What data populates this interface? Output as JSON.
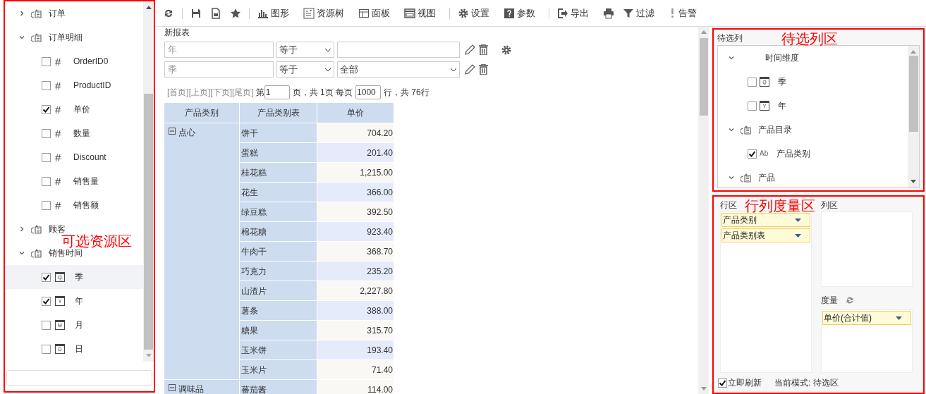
{
  "resource_panel": {
    "annotation": "可选资源区",
    "tree": [
      {
        "label": "订单",
        "kind": "table",
        "expanded": false
      },
      {
        "label": "订单明细",
        "kind": "table",
        "expanded": true,
        "children": [
          {
            "label": "OrderID0",
            "kind": "measure",
            "glyph": "#",
            "checked": false,
            "selected": false
          },
          {
            "label": "ProductID",
            "kind": "measure",
            "glyph": "#",
            "checked": false,
            "selected": false
          },
          {
            "label": "单价",
            "kind": "measure",
            "glyph": "#",
            "checked": true,
            "selected": false
          },
          {
            "label": "数量",
            "kind": "measure",
            "glyph": "#",
            "checked": false,
            "selected": false
          },
          {
            "label": "Discount",
            "kind": "measure",
            "glyph": "#",
            "checked": false,
            "selected": false
          },
          {
            "label": "销售量",
            "kind": "measure",
            "glyph": "#",
            "checked": false,
            "selected": false
          },
          {
            "label": "销售额",
            "kind": "measure",
            "glyph": "#",
            "checked": false,
            "selected": false
          }
        ]
      },
      {
        "label": "顾客",
        "kind": "table",
        "expanded": false
      },
      {
        "label": "销售时间",
        "kind": "table",
        "expanded": true,
        "children": [
          {
            "label": "季",
            "kind": "date",
            "glyph": "Q",
            "checked": true,
            "selected": true
          },
          {
            "label": "年",
            "kind": "date",
            "glyph": "Y",
            "checked": true,
            "selected": false
          },
          {
            "label": "月",
            "kind": "date",
            "glyph": "M",
            "checked": false,
            "selected": false
          },
          {
            "label": "日",
            "kind": "date",
            "glyph": "D",
            "checked": false,
            "selected": false
          }
        ]
      }
    ]
  },
  "toolbar": [
    {
      "kind": "button"
    },
    {
      "kind": "separator"
    },
    {
      "kind": "button"
    },
    {
      "kind": "button"
    },
    {
      "kind": "button"
    },
    {
      "kind": "separator"
    },
    {
      "kind": "button",
      "label": "图形"
    },
    {
      "kind": "button",
      "label": "资源树"
    },
    {
      "kind": "button",
      "label": "面板"
    },
    {
      "kind": "button",
      "label": "视图"
    },
    {
      "kind": "separator"
    },
    {
      "kind": "button",
      "label": "设置"
    },
    {
      "kind": "button",
      "label": "参数"
    },
    {
      "kind": "separator"
    },
    {
      "kind": "button",
      "label": "导出"
    },
    {
      "kind": "button"
    },
    {
      "kind": "button",
      "label": "过滤"
    },
    {
      "kind": "button",
      "label": "告警"
    }
  ],
  "report": {
    "title": "新报表",
    "filters": [
      {
        "placeholder": "年",
        "operator": "等于",
        "kind": "input",
        "settings": true
      },
      {
        "placeholder": "季",
        "operator": "等于",
        "kind": "select",
        "value": "全部",
        "settings": false
      }
    ],
    "pager": {
      "links": [
        "[首页]",
        "[上页]",
        "[下页]",
        "[尾页]"
      ],
      "page_prefix": "第",
      "page": "1",
      "page_suffix": "页，共 1页 每页",
      "page_size": "1000",
      "total": "行，共 76行"
    },
    "table": {
      "columns": [
        "产品类别",
        "产品类别表",
        "单价"
      ],
      "groups": [
        {
          "label": "点心",
          "expanded": true,
          "rows": [
            {
              "item": "饼干",
              "value": "704.20"
            },
            {
              "item": "蛋糕",
              "value": "201.40"
            },
            {
              "item": "桂花糕",
              "value": "1,215.00"
            },
            {
              "item": "花生",
              "value": "366.00"
            },
            {
              "item": "绿豆糕",
              "value": "392.50"
            },
            {
              "item": "棉花糖",
              "value": "923.40"
            },
            {
              "item": "牛肉干",
              "value": "368.70"
            },
            {
              "item": "巧克力",
              "value": "235.20"
            },
            {
              "item": "山渣片",
              "value": "2,227.80"
            },
            {
              "item": "薯条",
              "value": "388.00"
            },
            {
              "item": "糖果",
              "value": "315.70"
            },
            {
              "item": "玉米饼",
              "value": "193.40"
            },
            {
              "item": "玉米片",
              "value": "71.40"
            }
          ]
        },
        {
          "label": "调味品",
          "expanded": true,
          "rows": [
            {
              "item": "蕃茄酱",
              "value": "114.00"
            }
          ]
        }
      ]
    }
  },
  "pending_columns": {
    "title": "待选列",
    "annotation": "待选列区",
    "tree": [
      {
        "label": "时间维度",
        "kind": "dimension",
        "expanded": true,
        "children": [
          {
            "label": "季",
            "kind": "date",
            "glyph": "Q",
            "checked": false
          },
          {
            "label": "年",
            "kind": "date",
            "glyph": "Y",
            "checked": false
          }
        ]
      },
      {
        "label": "产品目录",
        "kind": "table",
        "expanded": true,
        "children": [
          {
            "label": "产品类别",
            "kind": "text",
            "glyph": "Ab",
            "checked": true
          }
        ]
      },
      {
        "label": "产品",
        "kind": "table",
        "expanded": true
      }
    ]
  },
  "layout_zones": {
    "annotation": "行列度量区",
    "row_zone": {
      "title": "行区",
      "chips": [
        "产品类别",
        "产品类别表"
      ]
    },
    "column_zone": {
      "title": "列区"
    },
    "measure_zone": {
      "title": "度量",
      "chips": [
        "单价(合计值)"
      ]
    },
    "auto_refresh": {
      "label": "立即刷新",
      "checked": true
    },
    "mode": "当前模式: 待选区"
  }
}
